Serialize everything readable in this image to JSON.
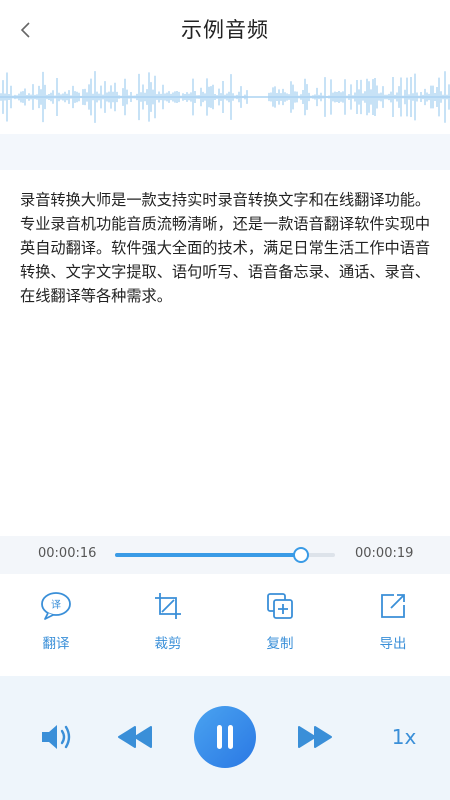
{
  "header": {
    "title": "示例音频",
    "back_icon": "chevron-left-icon"
  },
  "content": {
    "text": "录音转换大师是一款支持实时录音转换文字和在线翻译功能。专业录音机功能音质流畅清晰，还是一款语音翻译软件实现中英自动翻译。软件强大全面的技术，满足日常生活工作中语音转换、文字文字提取、语句听写、语音备忘录、通话、录音、在线翻译等各种需求。"
  },
  "player": {
    "current_time": "00:00:16",
    "total_time": "00:00:19",
    "progress": 0.84,
    "speed": "1x",
    "state": "playing"
  },
  "tools": [
    {
      "label": "翻译",
      "icon": "translate-icon"
    },
    {
      "label": "裁剪",
      "icon": "crop-icon"
    },
    {
      "label": "复制",
      "icon": "copy-icon"
    },
    {
      "label": "导出",
      "icon": "export-icon"
    }
  ],
  "colors": {
    "accent": "#3a9be6",
    "waveform": "#8fc4ee",
    "panel": "#eef5fb"
  }
}
